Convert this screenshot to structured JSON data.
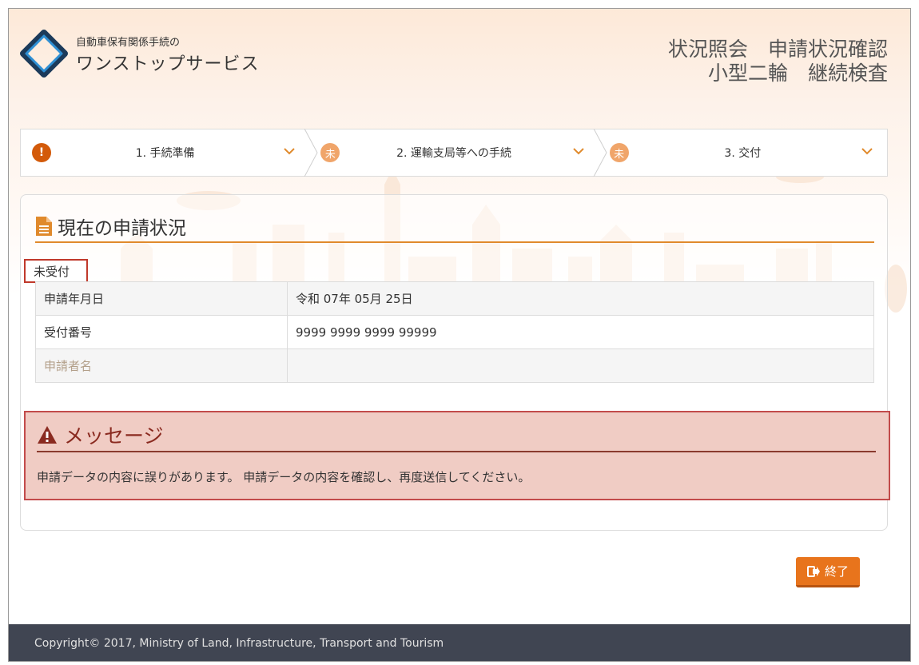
{
  "header": {
    "logo_subtitle": "自動車保有関係手続の",
    "logo_title": "ワンストップサービス",
    "page_title_line1": "状況照会　申請状況確認",
    "page_title_line2": "小型二輪　継続検査"
  },
  "steps": [
    {
      "label": "1. 手続準備",
      "badge": "!",
      "badge_type": "alert-icon"
    },
    {
      "label": "2. 運輸支局等への手続",
      "badge": "未",
      "badge_type": "pending"
    },
    {
      "label": "3. 交付",
      "badge": "未",
      "badge_type": "pending"
    }
  ],
  "status_section": {
    "title": "現在の申請状況",
    "status_label": "未受付",
    "rows": [
      {
        "key": "申請年月日",
        "value": "令和 07年 05月 25日"
      },
      {
        "key": "受付番号",
        "value": "9999 9999 9999 99999"
      },
      {
        "key": "申請者名",
        "value": ""
      }
    ]
  },
  "message": {
    "title": "メッセージ",
    "text": "申請データの内容に誤りがあります。 申請データの内容を確認し、再度送信してください。"
  },
  "buttons": {
    "exit_label": "終了"
  },
  "footer": {
    "copyright": "Copyright© 2017, Ministry of Land, Infrastructure, Transport and Tourism"
  },
  "colors": {
    "accent": "#e8741c",
    "alert_badge": "#d35a0a",
    "pending_badge": "#f0a56a",
    "message_bg": "#f0ccc4",
    "message_border": "#c24b4b",
    "footer_bg": "#404552"
  }
}
